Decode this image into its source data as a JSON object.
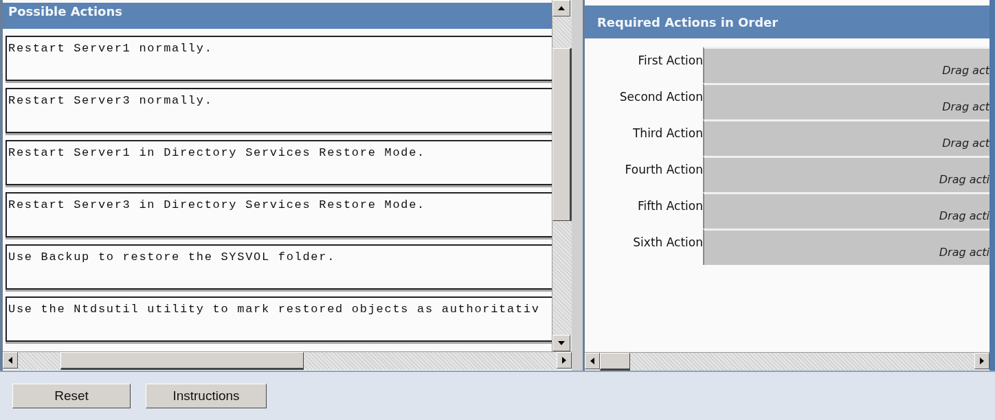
{
  "possible_actions": {
    "title": "Possible Actions",
    "items": [
      {
        "text": "Restart Server1 normally."
      },
      {
        "text": "Restart Server3 normally."
      },
      {
        "text": "Restart Server1 in Directory Services Restore Mode."
      },
      {
        "text": "Restart Server3 in Directory Services Restore Mode."
      },
      {
        "text": "Use Backup to restore the SYSVOL folder."
      },
      {
        "text": "Use the Ntdsutil utility to mark restored objects as authoritativ"
      }
    ]
  },
  "required_actions": {
    "title": "Required Actions in Order",
    "slots": [
      {
        "label": "First Action",
        "placeholder": "Drag act"
      },
      {
        "label": "Second Action",
        "placeholder": "Drag act"
      },
      {
        "label": "Third Action",
        "placeholder": "Drag act"
      },
      {
        "label": "Fourth Action",
        "placeholder": "Drag acti"
      },
      {
        "label": "Fifth Action",
        "placeholder": "Drag acti"
      },
      {
        "label": "Sixth Action",
        "placeholder": "Drag acti"
      }
    ]
  },
  "buttons": [
    {
      "label": "Reset"
    },
    {
      "label": "Instructions"
    }
  ]
}
